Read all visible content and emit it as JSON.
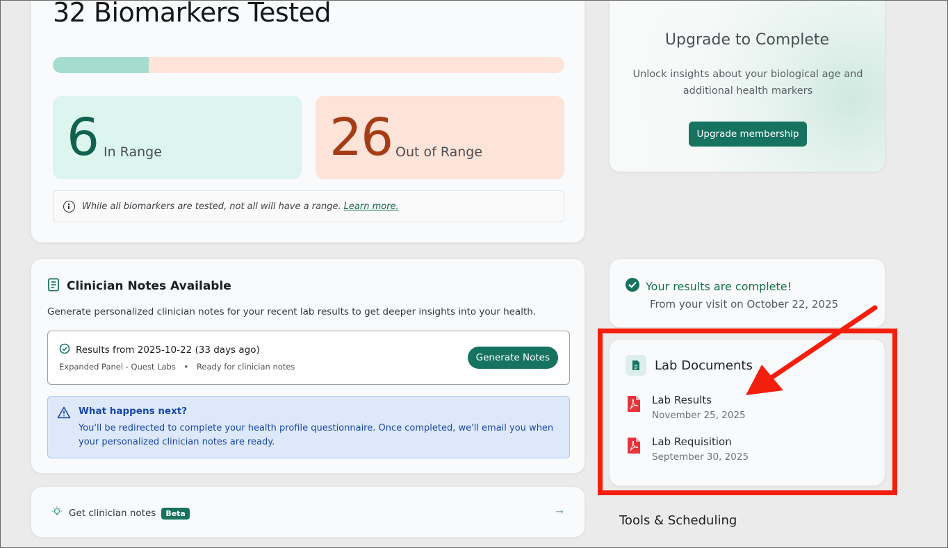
{
  "biomarkers": {
    "title": "32 Biomarkers Tested",
    "in_range_fraction": 0.1875,
    "in_range_count": "6",
    "in_range_label": "In Range",
    "out_range_count": "26",
    "out_range_label": "Out of Range",
    "info_text": "While all biomarkers are tested, not all will have a range.",
    "info_link": "Learn more."
  },
  "clinician_notes": {
    "title": "Clinician Notes Available",
    "description": "Generate personalized clinician notes for your recent lab results to get deeper insights into your health.",
    "result_title": "Results from 2025-10-22 (33 days ago)",
    "result_panel": "Expanded Panel - Quest Labs",
    "result_separator": "•",
    "result_status": "Ready for clinician notes",
    "generate_button": "Generate Notes",
    "next_title": "What happens next?",
    "next_body": "You'll be redirected to complete your health profile questionnaire. Once completed, we'll email you when your personalized clinician notes are ready."
  },
  "get_notes": {
    "label": "Get clinician notes",
    "badge": "Beta",
    "arrow": "→"
  },
  "upgrade": {
    "title": "Upgrade to Complete",
    "description": "Unlock insights about your biological age and additional health markers",
    "button": "Upgrade membership"
  },
  "results_complete": {
    "title": "Your results are complete!",
    "subtitle": "From your visit on October 22, 2025"
  },
  "lab_documents": {
    "title": "Lab Documents",
    "items": [
      {
        "name": "Lab Results",
        "date": "November 25, 2025",
        "icon": "pdf-icon"
      },
      {
        "name": "Lab Requisition",
        "date": "September 30, 2025",
        "icon": "pdf-icon"
      }
    ]
  },
  "tools": {
    "title": "Tools & Scheduling"
  },
  "colors": {
    "brand_green": "#157360",
    "in_range_bg": "#dcf5ee",
    "out_range_bg": "#fde3d8",
    "annotation_red": "#f41e0c"
  }
}
